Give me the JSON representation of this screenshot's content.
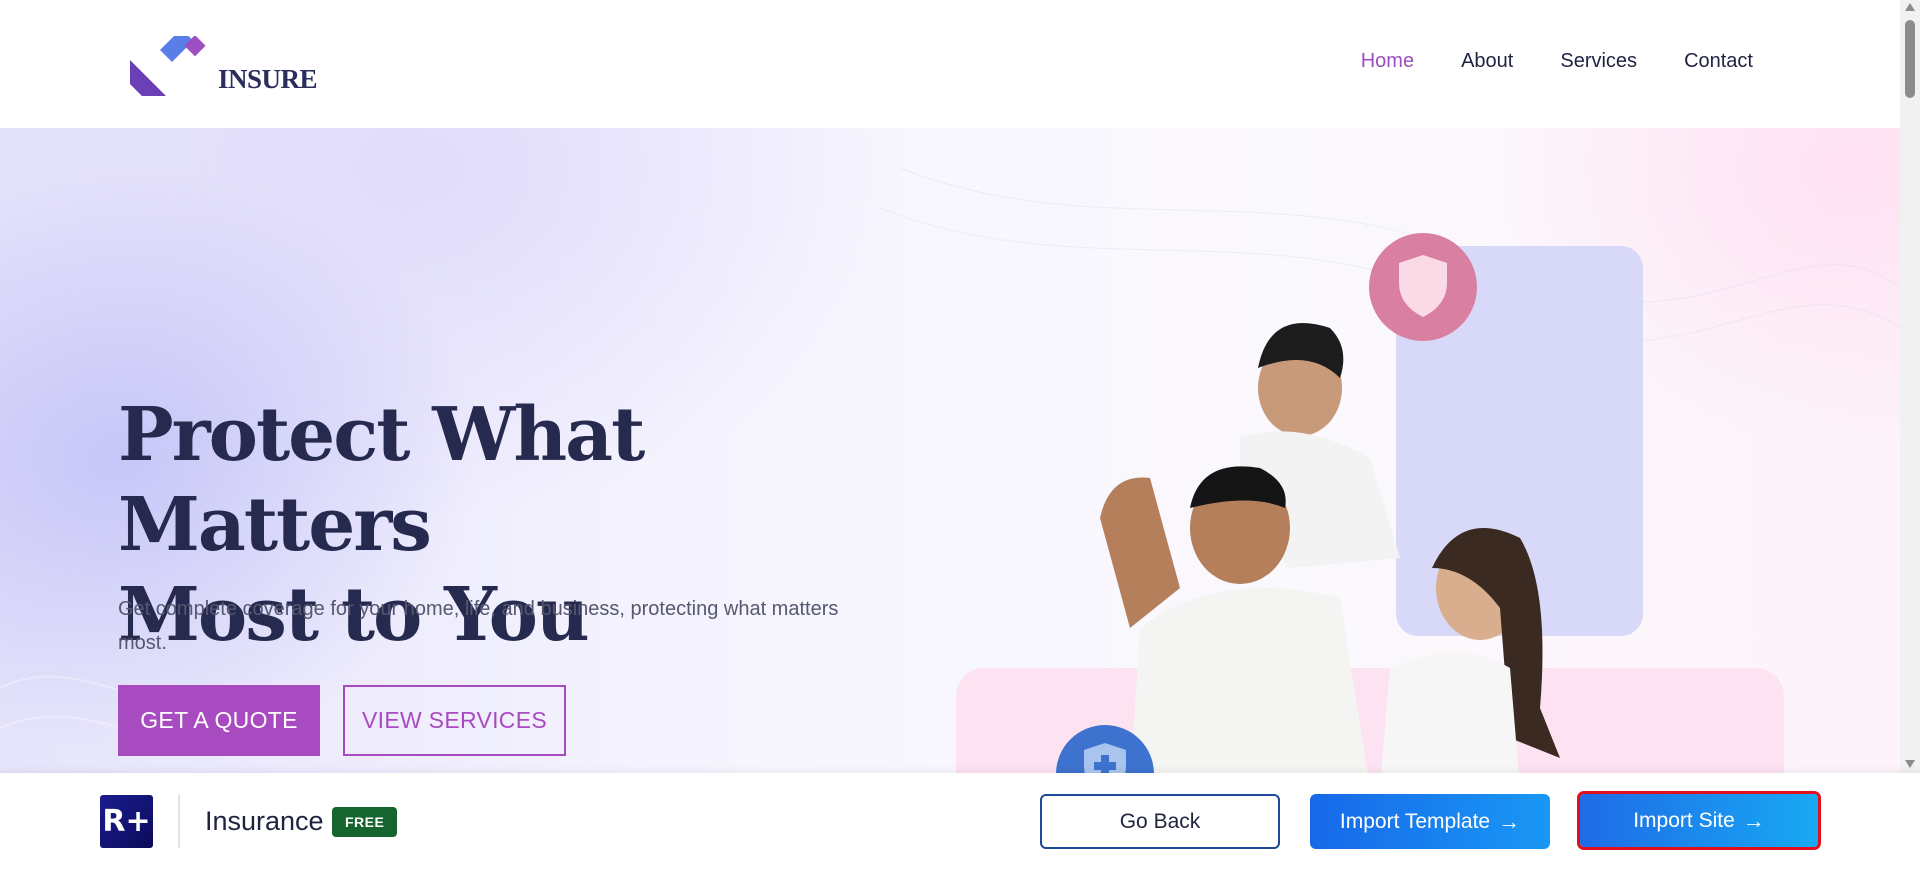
{
  "header": {
    "logo_text": "INSURE",
    "nav": [
      {
        "label": "Home",
        "active": true
      },
      {
        "label": "About",
        "active": false
      },
      {
        "label": "Services",
        "active": false
      },
      {
        "label": "Contact",
        "active": false
      }
    ]
  },
  "hero": {
    "title_line1": "Protect What Matters",
    "title_line2": "Most to You",
    "subtitle": "Get complete coverage for your home, life, and business, protecting what matters most.",
    "quote_button": "GET A QUOTE",
    "services_button": "VIEW SERVICES"
  },
  "bottom_bar": {
    "brand_icon": "R+",
    "template_name": "Insurance",
    "badge": "FREE",
    "go_back": "Go Back",
    "import_template": "Import Template",
    "import_site": "Import Site",
    "arrow_icon": "→"
  },
  "colors": {
    "accent": "#a94bc0",
    "nav_active": "#9b4fc1",
    "primary_blue": "#1768e8",
    "badge_green": "#16652e",
    "highlight_red": "#e0101e"
  }
}
